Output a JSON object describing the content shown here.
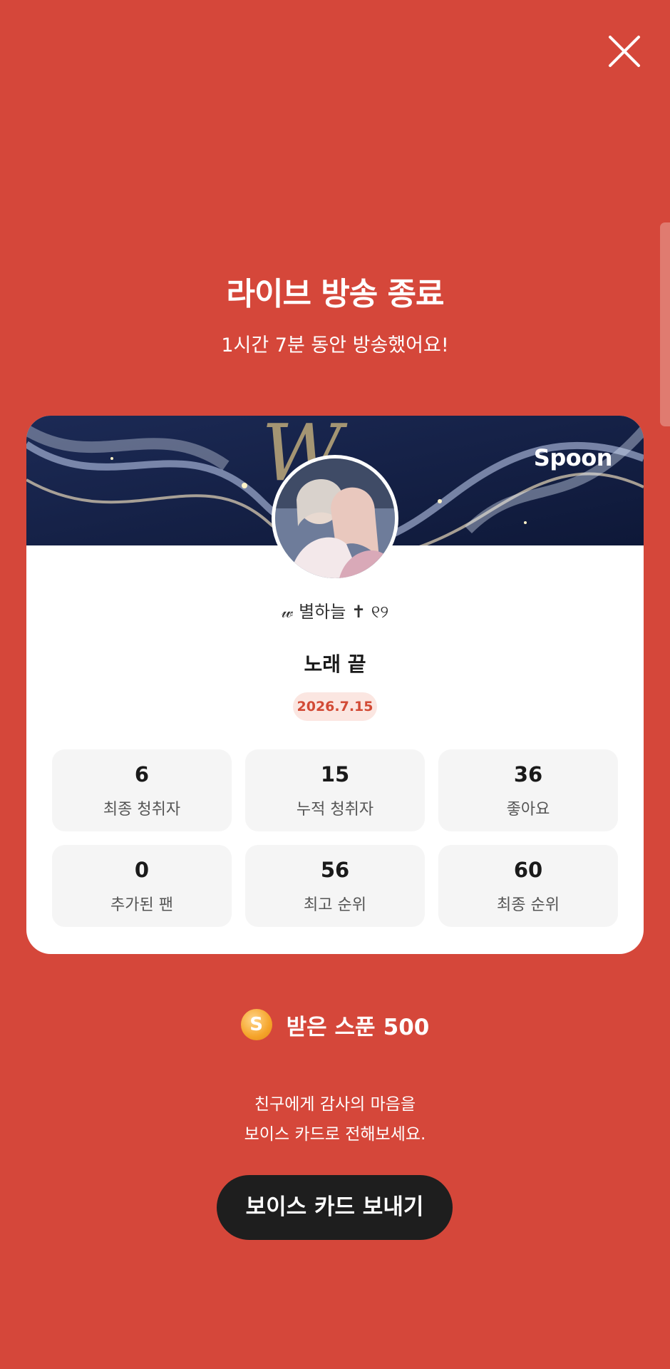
{
  "header": {
    "title": "라이브 방송 종료",
    "subtitle": "1시간 7분 동안 방송했어요!",
    "close_icon": "close-icon"
  },
  "card": {
    "brand": "Spoon",
    "nickname": "𝓌 별하늘 ✝ ୧୨",
    "song_title": "노래 끝",
    "date": "2026.7.15",
    "stats": [
      {
        "value": "6",
        "label": "최종 청취자"
      },
      {
        "value": "15",
        "label": "누적 청취자"
      },
      {
        "value": "36",
        "label": "좋아요"
      },
      {
        "value": "0",
        "label": "추가된 팬"
      },
      {
        "value": "56",
        "label": "최고 순위"
      },
      {
        "value": "60",
        "label": "최종 순위"
      }
    ]
  },
  "spoons": {
    "coin_symbol": "S",
    "label": "받은 스푼",
    "count": "500"
  },
  "message": {
    "line1": "친구에게 감사의 마음을",
    "line2": "보이스 카드로 전해보세요."
  },
  "actions": {
    "send_label": "보이스 카드 보내기"
  },
  "colors": {
    "background": "#D5473A",
    "card": "#FFFFFF",
    "button": "#1E1E1E",
    "date_badge_bg": "#FBE6E1",
    "date_badge_text": "#D24A35"
  }
}
